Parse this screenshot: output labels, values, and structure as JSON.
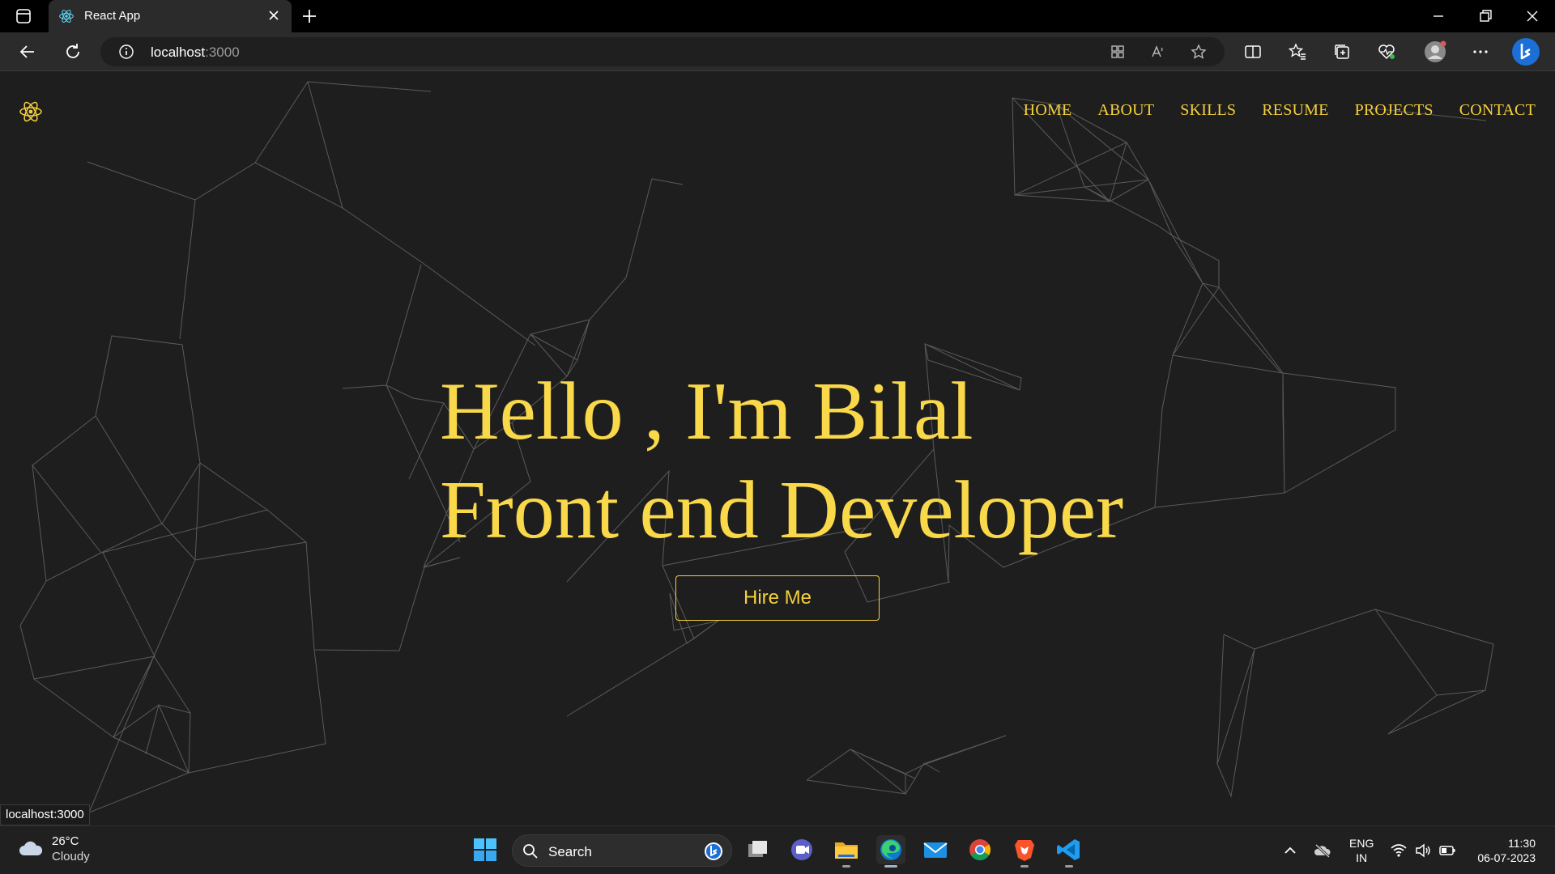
{
  "browser": {
    "tab_title": "React App",
    "url_host": "localhost",
    "url_port": ":3000",
    "status_url": "localhost:3000"
  },
  "site": {
    "nav": [
      "HOME",
      "ABOUT",
      "SKILLS",
      "RESUME",
      "PROJECTS",
      "CONTACT"
    ],
    "hero_line1": "Hello , I'm Bilal",
    "hero_line2": "Front end Developer",
    "cta_label": "Hire Me",
    "accent_color": "#f5d03b",
    "background_color": "#1e1e1e"
  },
  "taskbar": {
    "weather_temp": "26°C",
    "weather_condition": "Cloudy",
    "search_label": "Search",
    "lang_line1": "ENG",
    "lang_line2": "IN",
    "time": "11:30",
    "date": "06-07-2023",
    "apps": [
      "start-icon",
      "task-view-icon",
      "teams-icon",
      "file-explorer-icon",
      "edge-icon",
      "mail-icon",
      "chrome-icon",
      "brave-icon",
      "vscode-icon"
    ]
  }
}
